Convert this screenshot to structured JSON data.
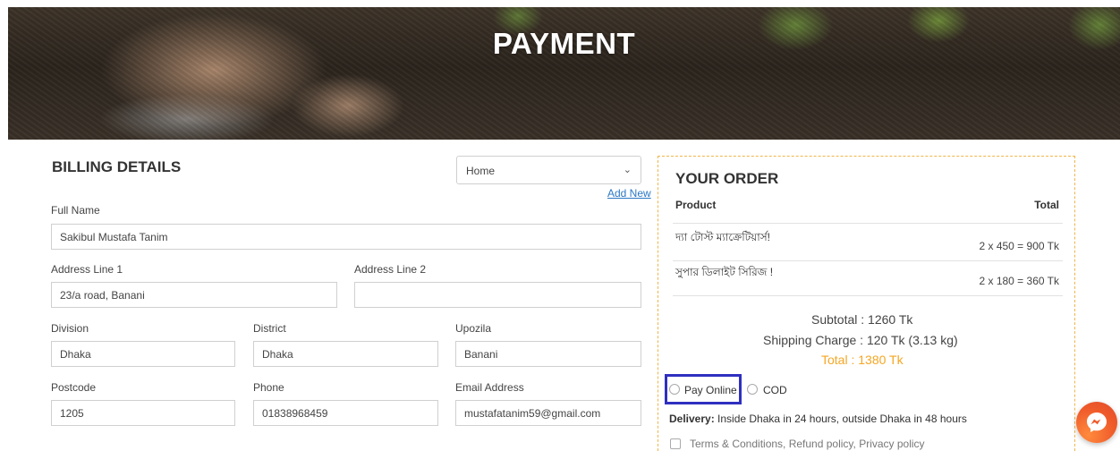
{
  "hero": {
    "title": "PAYMENT"
  },
  "billing": {
    "heading": "BILLING DETAILS",
    "address_select": {
      "value": "Home"
    },
    "add_new": "Add New",
    "full_name": {
      "label": "Full Name",
      "value": "Sakibul Mustafa Tanim"
    },
    "address_line_1": {
      "label": "Address Line 1",
      "value": "23/a road, Banani"
    },
    "address_line_2": {
      "label": "Address Line 2",
      "value": ""
    },
    "division": {
      "label": "Division",
      "value": "Dhaka"
    },
    "district": {
      "label": "District",
      "value": "Dhaka"
    },
    "upozila": {
      "label": "Upozila",
      "value": "Banani"
    },
    "postcode": {
      "label": "Postcode",
      "value": "1205"
    },
    "phone": {
      "label": "Phone",
      "value": "01838968459"
    },
    "email": {
      "label": "Email Address",
      "value": "mustafatanim59@gmail.com"
    }
  },
  "order": {
    "heading": "YOUR ORDER",
    "col_product": "Product",
    "col_total": "Total",
    "items": [
      {
        "name": "দ্যা টোস্ট ম্যাক্রেটিয়ার্স!",
        "price": "2 x  450 =  900 Tk"
      },
      {
        "name": "সুপার ডিলাইট সিরিজ !",
        "price": "2 x  180 =  360 Tk"
      }
    ],
    "subtotal": "Subtotal :  1260 Tk",
    "shipping": "Shipping Charge :  120 Tk (3.13 kg)",
    "total": "Total :  1380 Tk",
    "payment_options": [
      "Pay Online",
      "COD"
    ],
    "delivery_label": "Delivery:",
    "delivery_text": " Inside Dhaka in 24 hours, outside Dhaka in 48 hours",
    "terms": "Terms & Conditions, Refund policy, Privacy policy"
  },
  "colors": {
    "accent_orange": "#f5a623",
    "link_blue": "#2b78c5",
    "focus_blue": "#2f2fc0",
    "order_border": "#f0b64a"
  }
}
